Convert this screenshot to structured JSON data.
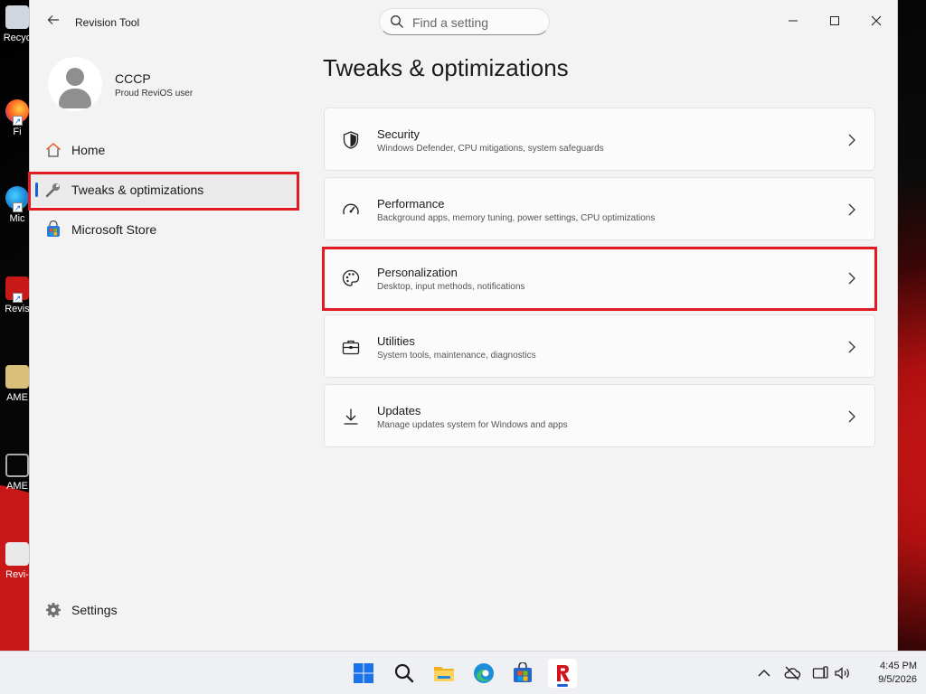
{
  "desktop": {
    "icons": [
      {
        "label": "Recyc"
      },
      {
        "label": "Fi"
      },
      {
        "label": "Mic"
      },
      {
        "label": "Revis"
      },
      {
        "label": "AME"
      },
      {
        "label": "AME"
      },
      {
        "label": "Revi-"
      }
    ]
  },
  "window": {
    "title": "Revision Tool",
    "search_placeholder": "Find a setting",
    "controls": {
      "minimize": "—",
      "maximize": "☐",
      "close": "✕"
    }
  },
  "profile": {
    "name": "CCCP",
    "subtitle": "Proud ReviOS user"
  },
  "sidebar": {
    "items": [
      {
        "label": "Home",
        "icon": "home-icon"
      },
      {
        "label": "Tweaks & optimizations",
        "icon": "wrench-icon",
        "active": true
      },
      {
        "label": "Microsoft Store",
        "icon": "store-icon"
      }
    ],
    "settings_label": "Settings"
  },
  "main": {
    "page_title": "Tweaks & optimizations",
    "cards": [
      {
        "title": "Security",
        "subtitle": "Windows Defender, CPU mitigations, system safeguards",
        "icon": "shield-icon"
      },
      {
        "title": "Performance",
        "subtitle": "Background apps, memory tuning, power settings, CPU optimizations",
        "icon": "gauge-icon"
      },
      {
        "title": "Personalization",
        "subtitle": "Desktop, input methods, notifications",
        "icon": "palette-icon",
        "highlighted": true
      },
      {
        "title": "Utilities",
        "subtitle": "System tools, maintenance, diagnostics",
        "icon": "toolbox-icon"
      },
      {
        "title": "Updates",
        "subtitle": "Manage updates system for Windows and apps",
        "icon": "download-icon"
      }
    ]
  },
  "taskbar": {
    "apps": [
      "start-icon",
      "search-icon",
      "file-explorer-icon",
      "edge-icon",
      "store-icon",
      "revision-tool-icon"
    ],
    "time": "4:45 PM",
    "date": "9/5/2026"
  },
  "colors": {
    "accent": "#1a5fd6",
    "highlight": "#e01b24",
    "window_bg": "#f3f3f3",
    "card_bg": "#fbfbfb"
  }
}
